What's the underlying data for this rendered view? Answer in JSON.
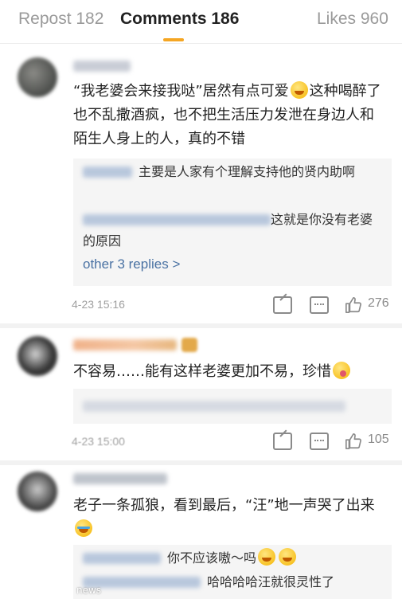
{
  "tabs": {
    "repost": "Repost 182",
    "comments": "Comments 186",
    "likes": "Likes 960"
  },
  "comments": [
    {
      "text_1": "“我老婆会来接我哒”居然有点可爱",
      "text_2": "这种喝醉了也不乱撒酒疯，也不把生活压力发泄在身边人和陌生人身上的人，真的不错",
      "emoji": "laugh-cry-emoji",
      "replies": [
        {
          "text": "主要是人家有个理解支持他的贤内助啊"
        },
        {
          "text": "这就是你没有老婆的原因"
        }
      ],
      "more_replies": "other 3 replies >",
      "time": "4-23 15:16",
      "likes": "276"
    },
    {
      "text": "不容易……能有这样老婆更加不易，珍惜",
      "emoji": "tongue-emoji",
      "time": "4-23 15:00",
      "likes": "105"
    },
    {
      "text_1": "老子一条孤狼，看到最后，“汪”地一声哭了出来",
      "emoji": "crying-emoji",
      "replies": [
        {
          "text": "你不应该嗷～吗"
        },
        {
          "text": "哈哈哈哈汪就很灵性了"
        }
      ]
    }
  ],
  "watermark": "news",
  "colors": {
    "accent": "#f5a623",
    "link": "#4a72a3",
    "reply_bg": "#f5f5f5",
    "muted": "#a0a0a0"
  }
}
